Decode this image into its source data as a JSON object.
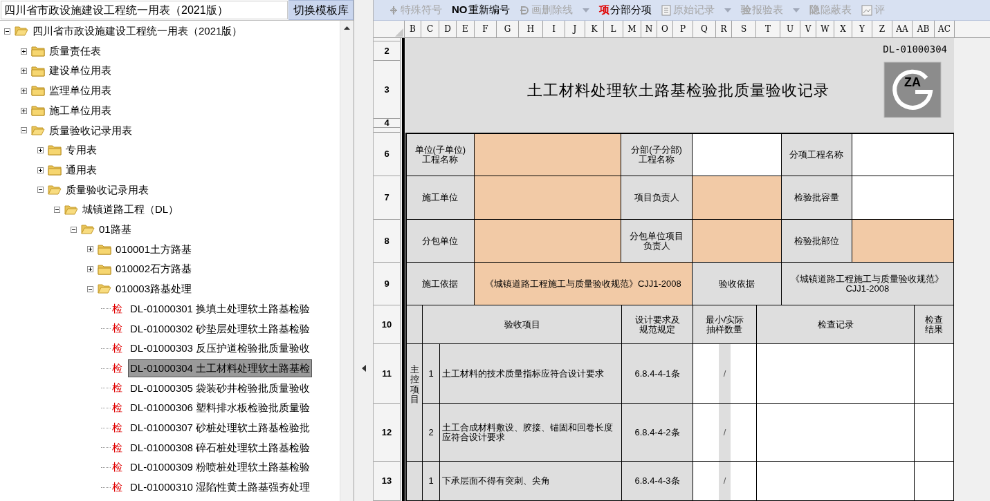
{
  "left_pane": {
    "library_field": {
      "value": "四川省市政设施建设工程统一用表（2021版）"
    },
    "switch_button": {
      "label": "切换模板库"
    },
    "tree": [
      {
        "label": "四川省市政设施建设工程统一用表（2021版）",
        "kind": "folder",
        "expanded": true,
        "children": [
          {
            "label": "质量责任表",
            "kind": "folder",
            "expanded": false
          },
          {
            "label": "建设单位用表",
            "kind": "folder",
            "expanded": false
          },
          {
            "label": "监理单位用表",
            "kind": "folder",
            "expanded": false
          },
          {
            "label": "施工单位用表",
            "kind": "folder",
            "expanded": false
          },
          {
            "label": "质量验收记录用表",
            "kind": "folder",
            "expanded": true,
            "children": [
              {
                "label": "专用表",
                "kind": "folder",
                "expanded": false
              },
              {
                "label": "通用表",
                "kind": "folder",
                "expanded": false
              },
              {
                "label": "质量验收记录用表",
                "kind": "folder",
                "expanded": true,
                "children": [
                  {
                    "label": "城镇道路工程（DL）",
                    "kind": "folder",
                    "expanded": true,
                    "children": [
                      {
                        "label": "01路基",
                        "kind": "folder",
                        "expanded": true,
                        "children": [
                          {
                            "label": "010001土方路基",
                            "kind": "folder",
                            "expanded": false
                          },
                          {
                            "label": "010002石方路基",
                            "kind": "folder",
                            "expanded": false
                          },
                          {
                            "label": "010003路基处理",
                            "kind": "folder",
                            "expanded": true,
                            "children": [
                              {
                                "label": "DL-01000301 换填土处理软土路基检验",
                                "kind": "form",
                                "badge": "检",
                                "selected": false
                              },
                              {
                                "label": "DL-01000302 砂垫层处理软土路基检验",
                                "kind": "form",
                                "badge": "检",
                                "selected": false
                              },
                              {
                                "label": "DL-01000303 反压护道检验批质量验收",
                                "kind": "form",
                                "badge": "检",
                                "selected": false
                              },
                              {
                                "label": "DL-01000304 土工材料处理软土路基检",
                                "kind": "form",
                                "badge": "检",
                                "selected": true
                              },
                              {
                                "label": "DL-01000305 袋装砂井检验批质量验收",
                                "kind": "form",
                                "badge": "检",
                                "selected": false
                              },
                              {
                                "label": "DL-01000306 塑料排水板检验批质量验",
                                "kind": "form",
                                "badge": "检",
                                "selected": false
                              },
                              {
                                "label": "DL-01000307 砂桩处理软土路基检验批",
                                "kind": "form",
                                "badge": "检",
                                "selected": false
                              },
                              {
                                "label": "DL-01000308 碎石桩处理软土路基检验",
                                "kind": "form",
                                "badge": "检",
                                "selected": false
                              },
                              {
                                "label": "DL-01000309 粉喷桩处理软土路基检验",
                                "kind": "form",
                                "badge": "检",
                                "selected": false
                              },
                              {
                                "label": "DL-01000310 湿陷性黄土路基强夯处理",
                                "kind": "form",
                                "badge": "检",
                                "selected": false
                              }
                            ]
                          }
                        ]
                      }
                    ]
                  }
                ]
              }
            ]
          }
        ]
      }
    ]
  },
  "toolbar": [
    {
      "kind": "icon",
      "label": "特殊符号",
      "disabled": true
    },
    {
      "kind": "glyph",
      "glyph": "NO",
      "label": "重新编号",
      "disabled": false
    },
    {
      "kind": "icon",
      "label": "画删除线",
      "disabled": true
    },
    {
      "kind": "caret",
      "disabled": true
    },
    {
      "kind": "glyph",
      "glyph": "项",
      "label": "分部分项",
      "disabled": false
    },
    {
      "kind": "icon",
      "label": "原始记录",
      "disabled": true
    },
    {
      "kind": "caret",
      "disabled": true
    },
    {
      "kind": "glyph",
      "glyph": "验",
      "label": "报验表",
      "disabled": true
    },
    {
      "kind": "caret",
      "disabled": true
    },
    {
      "kind": "glyph",
      "glyph": "隐",
      "label": "隐蔽表",
      "disabled": true
    },
    {
      "kind": "icon",
      "label": "评",
      "disabled": true
    }
  ],
  "sheet": {
    "columns": [
      "B",
      "C",
      "D",
      "E",
      "F",
      "G",
      "H",
      "I",
      "J",
      "K",
      "L",
      "M",
      "N",
      "O",
      "P",
      "Q",
      "R",
      "S",
      "T",
      "U",
      "V",
      "W",
      "X",
      "Y",
      "Z",
      "AA",
      "AB",
      "AC"
    ],
    "row_numbers": [
      "2",
      "3",
      "4",
      "6",
      "7",
      "8",
      "9",
      "10",
      "11",
      "12",
      "13"
    ],
    "form": {
      "code": "DL-01000304",
      "title": "土工材料处理软土路基检验批质量验收记录",
      "logo_text": "ZA",
      "info_rows": [
        {
          "cells": [
            {
              "label": "单位(子单位)工程名称",
              "value": {
                "highlighted": true
              }
            },
            {
              "label": "分部(子分部)工程名称",
              "value": {
                "highlighted": false
              }
            },
            {
              "label": "分项工程名称",
              "value": {
                "highlighted": false
              }
            }
          ]
        },
        {
          "cells": [
            {
              "label": "施工单位",
              "value": {
                "highlighted": true
              }
            },
            {
              "label": "项目负责人",
              "value": {
                "highlighted": true
              }
            },
            {
              "label": "检验批容量",
              "value": {
                "highlighted": false
              }
            }
          ]
        },
        {
          "cells": [
            {
              "label": "分包单位",
              "value": {
                "highlighted": true
              }
            },
            {
              "label": "分包单位项目负责人",
              "value": {
                "highlighted": true
              }
            },
            {
              "label": "检验批部位",
              "value": {
                "highlighted": true
              }
            }
          ]
        },
        {
          "cells": [
            {
              "label": "施工依据",
              "value": {
                "highlighted": true,
                "text": "《城镇道路工程施工与质量验收规范》CJJ1-2008"
              }
            },
            {
              "label": "验收依据",
              "value": {
                "highlighted": false,
                "text": "《城镇道路工程施工与质量验收规范》CJJ1-2008"
              }
            }
          ]
        }
      ],
      "check_header": [
        "验收项目",
        "设计要求及规范规定",
        "最小/实际抽样数量",
        "检查记录",
        "检查结果"
      ],
      "groups": [
        {
          "label": "主控项目",
          "items": [
            {
              "no": "1",
              "text": "土工材料的技术质量指标应符合设计要求",
              "spec": "6.8.4-4-1条",
              "sample": "/"
            },
            {
              "no": "2",
              "text": "土工合成材料敷设、胶接、锚固和回卷长度应符合设计要求",
              "spec": "6.8.4-4-2条",
              "sample": "/"
            }
          ]
        },
        {
          "items": [
            {
              "no": "1",
              "text": "下承层面不得有突刺、尖角",
              "spec": "6.8.4-4-3条",
              "sample": "/"
            }
          ]
        }
      ]
    }
  }
}
